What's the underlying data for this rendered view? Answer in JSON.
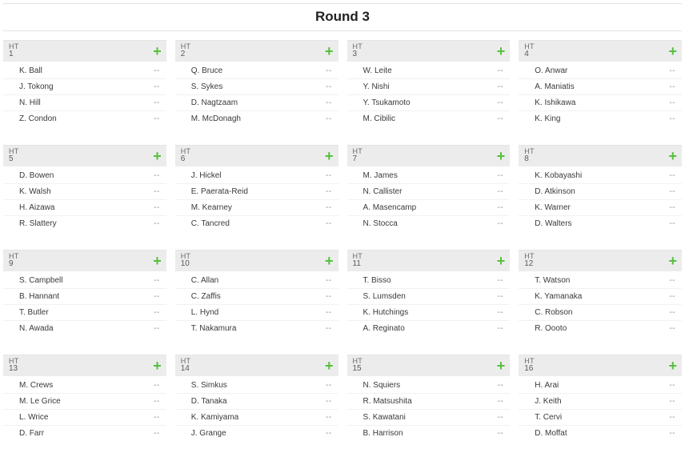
{
  "round_title": "Round 3",
  "heat_label": "HT",
  "empty_score": "--",
  "heats": [
    {
      "num": "1",
      "athletes": [
        "K. Ball",
        "J. Tokong",
        "N. Hill",
        "Z. Condon"
      ]
    },
    {
      "num": "2",
      "athletes": [
        "Q. Bruce",
        "S. Sykes",
        "D. Nagtzaam",
        "M. McDonagh"
      ]
    },
    {
      "num": "3",
      "athletes": [
        "W. Leite",
        "Y. Nishi",
        "Y. Tsukamoto",
        "M. Cibilic"
      ]
    },
    {
      "num": "4",
      "athletes": [
        "O. Anwar",
        "A. Maniatis",
        "K. Ishikawa",
        "K. King"
      ]
    },
    {
      "num": "5",
      "athletes": [
        "D. Bowen",
        "K. Walsh",
        "H. Aizawa",
        "R. Slattery"
      ]
    },
    {
      "num": "6",
      "athletes": [
        "J. Hickel",
        "E. Paerata-Reid",
        "M. Kearney",
        "C. Tancred"
      ]
    },
    {
      "num": "7",
      "athletes": [
        "M. James",
        "N. Callister",
        "A. Masencamp",
        "N. Stocca"
      ]
    },
    {
      "num": "8",
      "athletes": [
        "K. Kobayashi",
        "D. Atkinson",
        "K. Warner",
        "D. Walters"
      ]
    },
    {
      "num": "9",
      "athletes": [
        "S. Campbell",
        "B. Hannant",
        "T. Butler",
        "N. Awada"
      ]
    },
    {
      "num": "10",
      "athletes": [
        "C. Allan",
        "C. Zaffis",
        "L. Hynd",
        "T. Nakamura"
      ]
    },
    {
      "num": "11",
      "athletes": [
        "T. Bisso",
        "S. Lumsden",
        "K. Hutchings",
        "A. Reginato"
      ]
    },
    {
      "num": "12",
      "athletes": [
        "T. Watson",
        "K. Yamanaka",
        "C. Robson",
        "R. Oooto"
      ]
    },
    {
      "num": "13",
      "athletes": [
        "M. Crews",
        "M. Le Grice",
        "L. Wrice",
        "D. Farr"
      ]
    },
    {
      "num": "14",
      "athletes": [
        "S. Simkus",
        "D. Tanaka",
        "K. Kamiyama",
        "J. Grange"
      ]
    },
    {
      "num": "15",
      "athletes": [
        "N. Squiers",
        "R. Matsushita",
        "S. Kawatani",
        "B. Harrison"
      ]
    },
    {
      "num": "16",
      "athletes": [
        "H. Arai",
        "J. Keith",
        "T. Cervi",
        "D. Moffat"
      ]
    }
  ]
}
